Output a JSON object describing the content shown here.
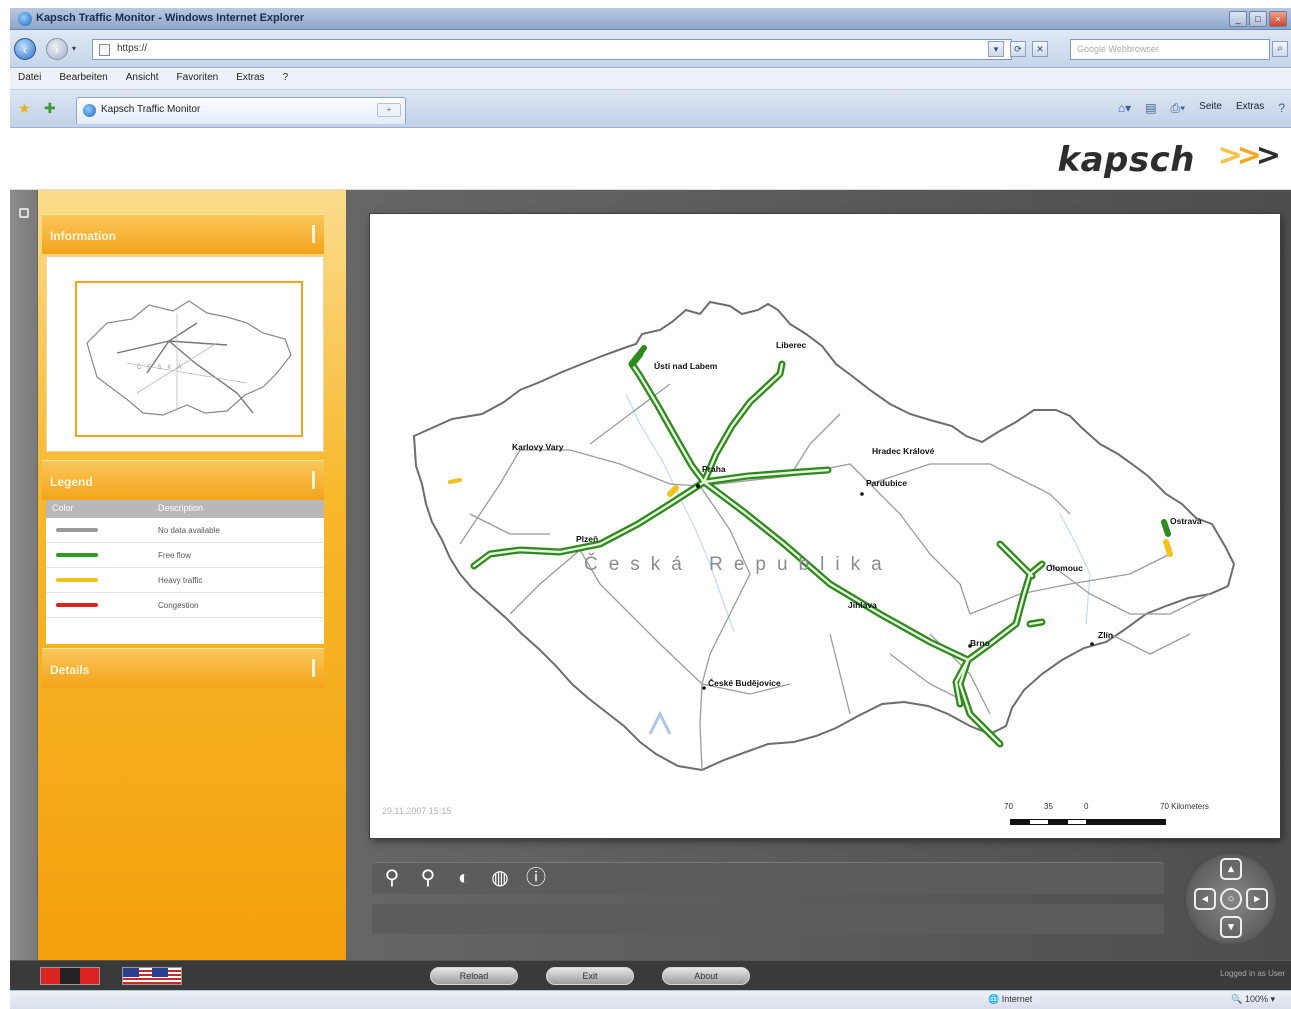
{
  "browser": {
    "window_title": "Kapsch Traffic Monitor - Windows Internet Explorer",
    "url": "https://",
    "search_placeholder": "Google Webbrowser",
    "menu": [
      "Datei",
      "Bearbeiten",
      "Ansicht",
      "Favoriten",
      "Extras",
      "?"
    ],
    "tab_title": "Kapsch Traffic Monitor",
    "command_bar": [
      "Seite",
      "Extras"
    ],
    "status_zone": "Internet",
    "status_zoom": "100%"
  },
  "app": {
    "logo_text": "kapsch",
    "panels": {
      "overview_title": "Information",
      "legend_title": "Legend",
      "details_title": "Details"
    },
    "legend": {
      "headers": [
        "Color",
        "Description"
      ],
      "rows": [
        {
          "color": "#9a9a9a",
          "label": "No data available"
        },
        {
          "color": "#2e9a1f",
          "label": "Free flow"
        },
        {
          "color": "#f2c31a",
          "label": "Heavy traffic"
        },
        {
          "color": "#d9241f",
          "label": "Congestion"
        }
      ]
    },
    "map": {
      "country_label": "Česká Republika",
      "timestamp": "29.11.2007 15:15",
      "scale_labels": [
        "70",
        "35",
        "0",
        "70 Kilometers"
      ],
      "cities": [
        "Liberec",
        "Ústí nad Labem",
        "Karlovy Vary",
        "Praha",
        "Hradec Králové",
        "Pardubice",
        "Plzeň",
        "Jihlava",
        "Ostrava",
        "Olomouc",
        "Brno",
        "Zlín",
        "České Budějovice"
      ]
    },
    "tools": [
      "zoom-in",
      "zoom-out",
      "refresh",
      "globe",
      "info"
    ],
    "bottom_buttons": [
      "Reload",
      "Exit",
      "About"
    ],
    "logged_in": "Logged in as User"
  }
}
